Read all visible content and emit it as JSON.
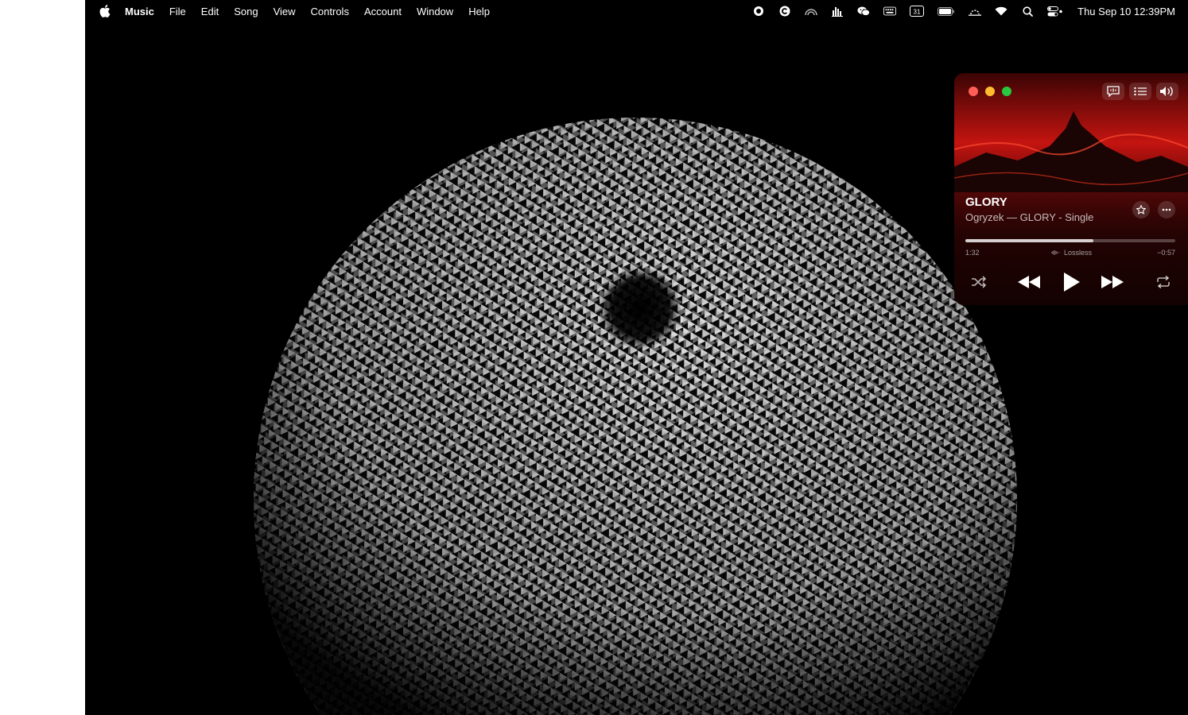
{
  "menubar": {
    "app_name": "Music",
    "items": [
      "File",
      "Edit",
      "Song",
      "View",
      "Controls",
      "Account",
      "Window",
      "Help"
    ],
    "status_icons": [
      "record-icon",
      "c-badge-icon",
      "rainbow-icon",
      "equalizer-icon",
      "wechat-icon",
      "keyboard-icon",
      "calendar-icon",
      "battery-icon",
      "sunrise-icon",
      "wifi-icon",
      "search-icon",
      "control-center-icon"
    ],
    "calendar_day": "31",
    "clock": "Thu Sep 10  12:39PM"
  },
  "player": {
    "title": "GLORY",
    "subtitle": "Ogryzek — GLORY - Single",
    "progress": 0.61,
    "elapsed": "1:32",
    "remaining": "−0:57",
    "quality": "Lossless",
    "icons": [
      "lyrics-icon",
      "queue-icon",
      "volume-icon",
      "star-icon",
      "more-icon",
      "shuffle-icon",
      "rewind-icon",
      "play-icon",
      "forward-icon",
      "repeat-icon"
    ],
    "colors": {
      "accent": "#c41410",
      "close": "#ff5f57",
      "minimize": "#febc2e",
      "zoom": "#28c840"
    }
  }
}
